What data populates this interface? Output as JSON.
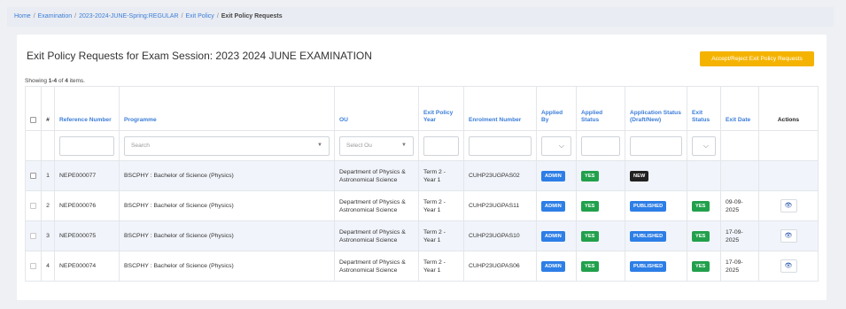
{
  "breadcrumb": {
    "home": "Home",
    "examination": "Examination",
    "session": "2023-2024-JUNE-Spring:REGULAR",
    "exit_policy": "Exit Policy",
    "current": "Exit Policy Requests",
    "separator": "/"
  },
  "page": {
    "title": "Exit Policy Requests for Exam Session: 2023 2024 JUNE EXAMINATION",
    "primary_button": "Accept/Reject Exit Policy Requests",
    "summary_prefix": "Showing ",
    "summary_range": "1-4",
    "summary_of": " of ",
    "summary_total": "4",
    "summary_suffix": " items."
  },
  "table": {
    "headers": {
      "num": "#",
      "reference": "Reference Number",
      "programme": "Programme",
      "ou": "OU",
      "year": "Exit Policy Year",
      "enrolment": "Enrolment Number",
      "applied_by": "Applied By",
      "applied_status": "Applied Status",
      "app_status": "Application Status (Draft/New)",
      "exit_status": "Exit Status",
      "exit_date": "Exit Date",
      "actions": "Actions"
    },
    "filters": {
      "programme_placeholder": "Search",
      "ou_placeholder": "Select Ou"
    },
    "rows": [
      {
        "num": "1",
        "ref": "NEPE000077",
        "programme": "BSCPHY : Bachelor of Science (Physics)",
        "ou": "Department of Physics & Astronomical Science",
        "year": "Term 2 - Year 1",
        "enrol": "CUHP23UGPAS02",
        "applied_by": "ADMIN",
        "applied_status": "YES",
        "app_status": "NEW",
        "exit_status": "",
        "exit_date": ""
      },
      {
        "num": "2",
        "ref": "NEPE000076",
        "programme": "BSCPHY : Bachelor of Science (Physics)",
        "ou": "Department of Physics & Astronomical Science",
        "year": "Term 2 - Year 1",
        "enrol": "CUHP23UGPAS11",
        "applied_by": "ADMIN",
        "applied_status": "YES",
        "app_status": "PUBLISHED",
        "exit_status": "YES",
        "exit_date": "09-09-2025"
      },
      {
        "num": "3",
        "ref": "NEPE000075",
        "programme": "BSCPHY : Bachelor of Science (Physics)",
        "ou": "Department of Physics & Astronomical Science",
        "year": "Term 2 - Year 1",
        "enrol": "CUHP23UGPAS10",
        "applied_by": "ADMIN",
        "applied_status": "YES",
        "app_status": "PUBLISHED",
        "exit_status": "YES",
        "exit_date": "17-09-2025"
      },
      {
        "num": "4",
        "ref": "NEPE000074",
        "programme": "BSCPHY : Bachelor of Science (Physics)",
        "ou": "Department of Physics & Astronomical Science",
        "year": "Term 2 - Year 1",
        "enrol": "CUHP23UGPAS06",
        "applied_by": "ADMIN",
        "applied_status": "YES",
        "app_status": "PUBLISHED",
        "exit_status": "YES",
        "exit_date": "17-09-2025"
      }
    ]
  },
  "icons": {
    "view": "eye-icon",
    "caret": "caret-down-icon",
    "chevron": "chevron-down-icon"
  },
  "colors": {
    "accent": "#3b7dd8",
    "primary_button": "#f5b301",
    "badge_blue": "#2d7ee6",
    "badge_green": "#22a04c",
    "badge_dark": "#222222"
  }
}
